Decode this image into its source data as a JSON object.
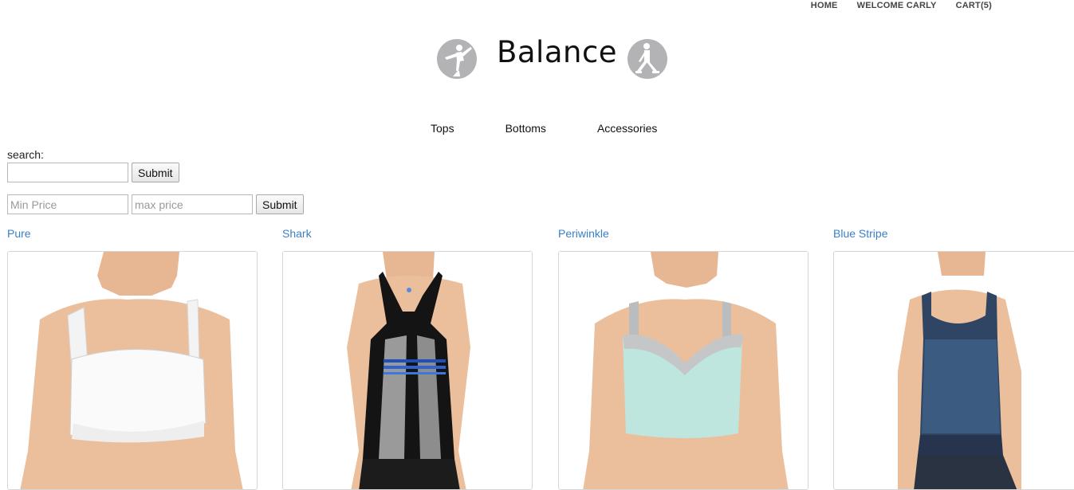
{
  "top_nav": {
    "home": "HOME",
    "welcome": "WELCOME CARLY",
    "cart": "CART(5)"
  },
  "brand": {
    "title": "Balance",
    "left_logo_icon": "yoga-pose-icon",
    "right_logo_icon": "yoga-pose-icon"
  },
  "categories": [
    "Tops",
    "Bottoms",
    "Accessories"
  ],
  "search": {
    "label": "search:",
    "value": "",
    "submit": "Submit"
  },
  "price_filter": {
    "min_placeholder": "Min Price",
    "max_placeholder": "max price",
    "submit": "Submit"
  },
  "products": [
    {
      "name": "Pure"
    },
    {
      "name": "Shark"
    },
    {
      "name": "Periwinkle"
    },
    {
      "name": "Blue Stripe"
    }
  ],
  "colors": {
    "link": "#3b7fc4",
    "logo_gray": "#b3b3b6",
    "skin": "#e7b793"
  }
}
